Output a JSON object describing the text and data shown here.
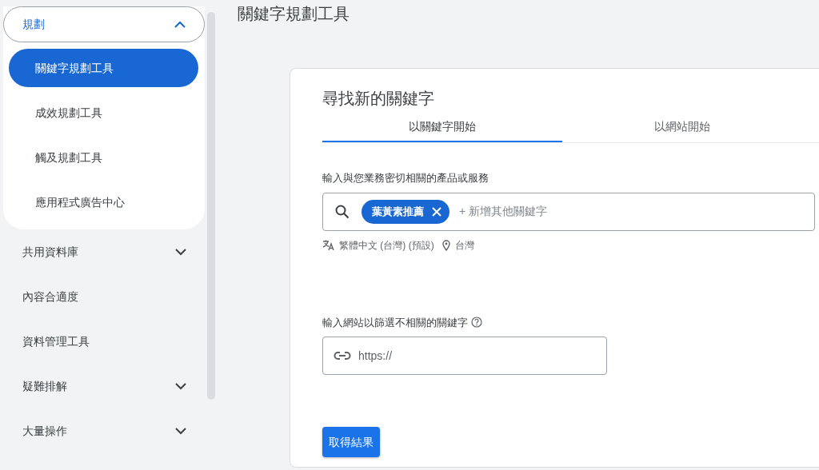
{
  "sidebar": {
    "items": [
      {
        "kind": "group",
        "label": "規劃",
        "expanded": true,
        "children": [
          {
            "label": "關鍵字規劃工具",
            "selected": true
          },
          {
            "label": "成效規劃工具",
            "selected": false
          },
          {
            "label": "觸及規劃工具",
            "selected": false
          },
          {
            "label": "應用程式廣告中心",
            "selected": false
          }
        ]
      },
      {
        "kind": "group",
        "label": "共用資料庫",
        "expanded": false
      },
      {
        "kind": "link",
        "label": "內容合適度"
      },
      {
        "kind": "link",
        "label": "資料管理工具"
      },
      {
        "kind": "group",
        "label": "疑難排解",
        "expanded": false
      },
      {
        "kind": "group",
        "label": "大量操作",
        "expanded": false
      }
    ]
  },
  "page_title": "關鍵字規劃工具",
  "card": {
    "title": "尋找新的關鍵字",
    "tabs": [
      {
        "label": "以關鍵字開始",
        "selected": true
      },
      {
        "label": "以網站開始",
        "selected": false
      }
    ],
    "keyword_label": "輸入與您業務密切相關的產品或服務",
    "keywords": [
      "葉黃素推薦"
    ],
    "keyword_placeholder": "+ 新增其他關鍵字",
    "language": "繁體中文 (台灣) (預設)",
    "location": "台灣",
    "site_label": "輸入網站以篩選不相關的關鍵字",
    "site_placeholder": "https://",
    "submit": "取得結果"
  }
}
